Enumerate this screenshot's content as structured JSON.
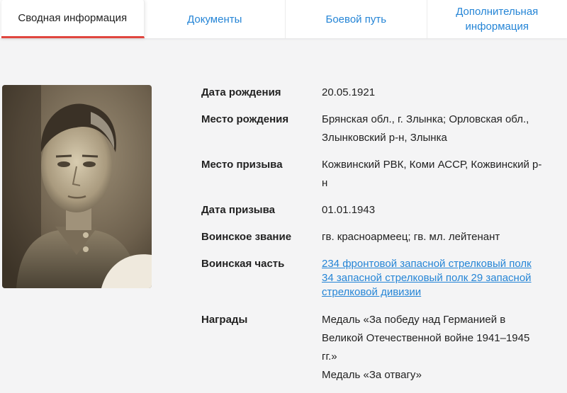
{
  "tabs": [
    {
      "label": "Сводная информация"
    },
    {
      "label": "Документы"
    },
    {
      "label": "Боевой путь"
    },
    {
      "label_line1": "Дополнительная",
      "label_line2": "информация"
    }
  ],
  "active_tab": "Сводная информация",
  "colors": {
    "accent_link": "#2585d6",
    "active_tab_underline": "#e0463f",
    "background": "#f4f4f5"
  },
  "profile": {
    "birth_date": {
      "label": "Дата рождения",
      "value": "20.05.1921"
    },
    "birth_place": {
      "label": "Место рождения",
      "line1": "Брянская обл., г. Злынка; Орловская обл.,",
      "line2": "Злынковский р-н, Злынка"
    },
    "draft_place": {
      "label": "Место призыва",
      "line1": "Кожвинский РВК, Коми АССР, Кожвинский р-",
      "line2": "н"
    },
    "draft_date": {
      "label": "Дата призыва",
      "value": "01.01.1943"
    },
    "rank": {
      "label": "Воинское звание",
      "value": "гв. красноармеец; гв. мл. лейтенант"
    },
    "unit": {
      "label": "Воинская часть",
      "link1": "234 фронтовой запасной стрелковый полк",
      "link2_line1": "34 запасной стрелковый полк 29 запасной",
      "link2_line2": "стрелковой дивизии"
    },
    "awards": {
      "label": "Награды",
      "award1_line1": "Медаль «За победу над Германией в",
      "award1_line2": "Великой Отечественной войне 1941–1945",
      "award1_line3": "гг.»",
      "award2": "Медаль «За отвагу»"
    }
  }
}
